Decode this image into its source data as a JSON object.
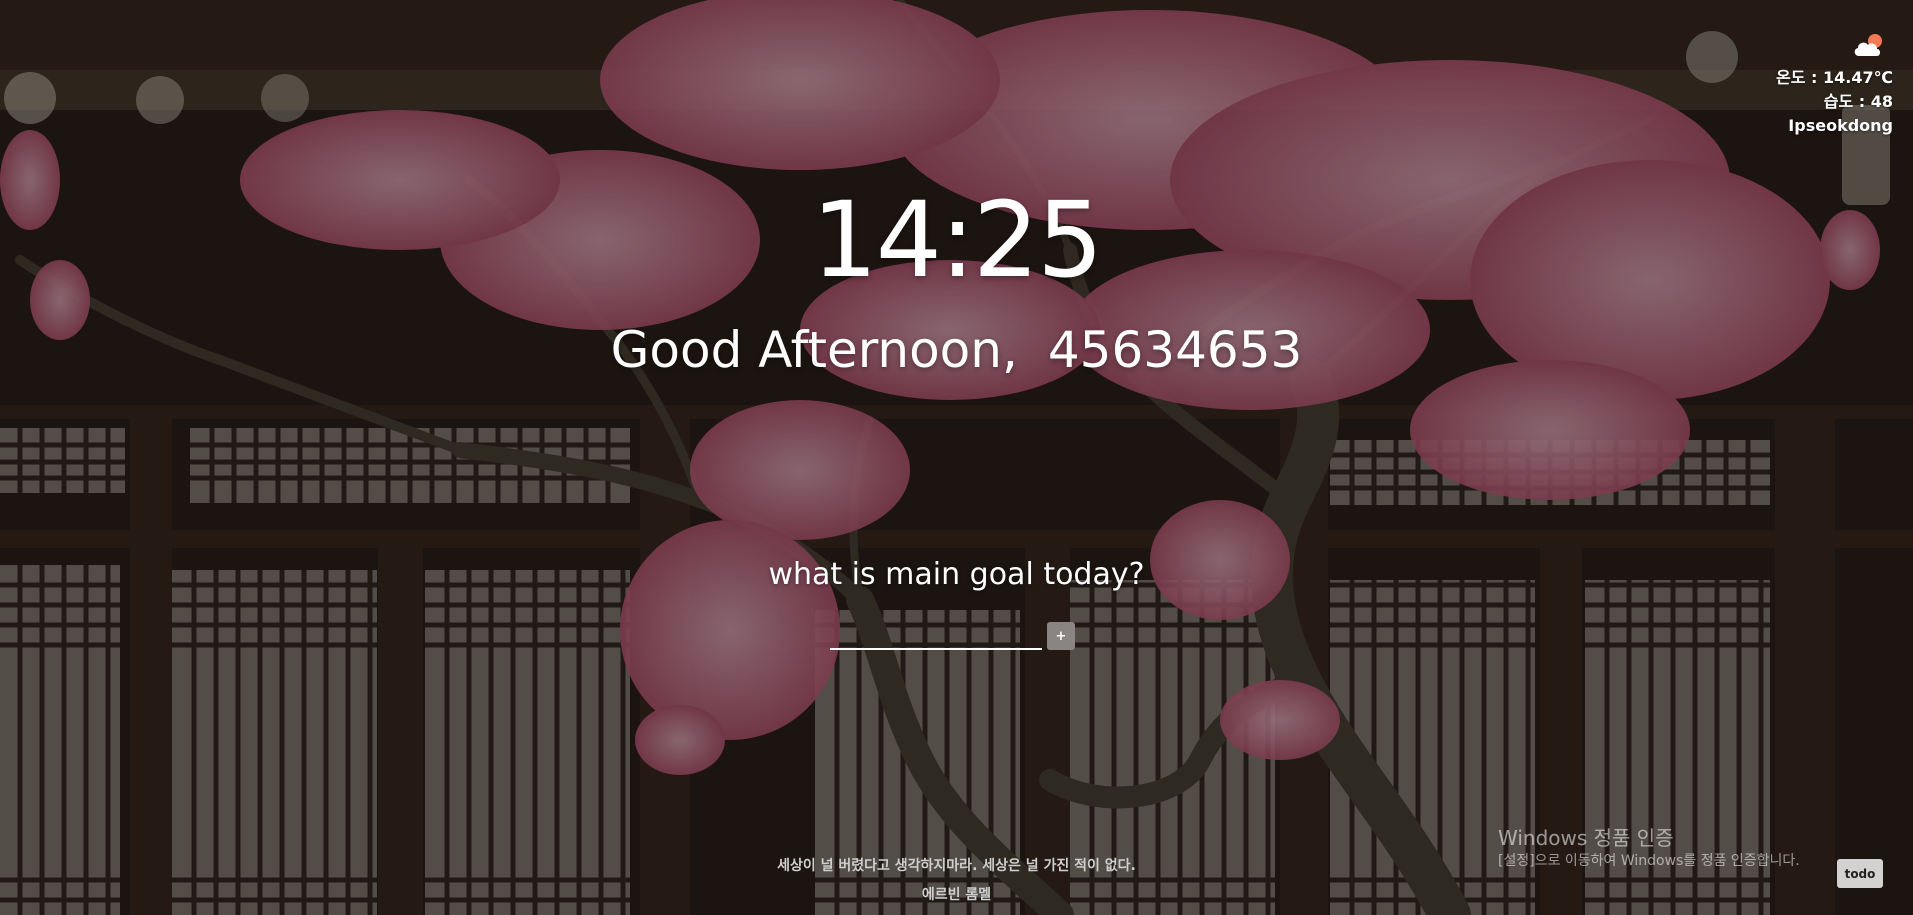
{
  "weather": {
    "icon": "cloud-sun-icon",
    "temperature": "온도 : 14.47℃",
    "humidity": "습도 : 48",
    "location": "Ipseokdong"
  },
  "clock": {
    "time": "14:25"
  },
  "greeting": {
    "text": "Good Afternoon,",
    "name": "45634653"
  },
  "goal": {
    "question": "what is main goal today?",
    "input_value": "",
    "add_label": "+"
  },
  "quote": {
    "text": "세상이 널 버렸다고 생각하지마라. 세상은 널 가진 적이 없다.",
    "author": "에르빈 롬멜"
  },
  "activation": {
    "title": "Windows 정품 인증",
    "subtitle": "[설정]으로 이동하여 Windows를 정품 인증합니다."
  },
  "todo": {
    "label": "todo"
  },
  "colors": {
    "text": "#ffffff",
    "wood_dark": "#2b1e18",
    "blossom": "#e89ab3",
    "button_gray": "#8a8583"
  }
}
